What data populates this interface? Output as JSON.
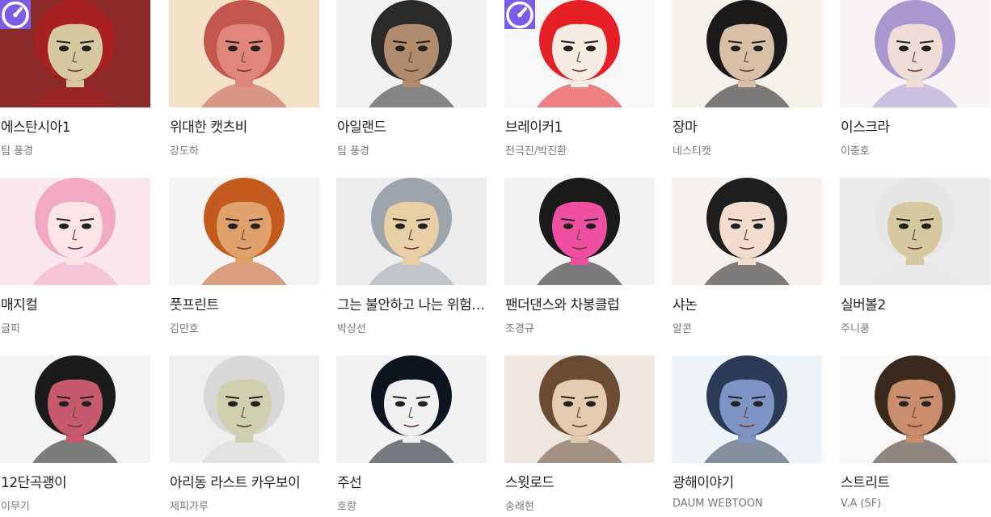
{
  "webtoons": [
    {
      "title": "에스탄시아1",
      "author": "팀 풍경",
      "badge": true,
      "thumb_icon": "red-haired-man-portrait",
      "bg": "#8b2a2a",
      "skin": "#d8c8a0",
      "hair": "#a82020"
    },
    {
      "title": "위대한 캣츠비",
      "author": "강도하",
      "badge": false,
      "thumb_icon": "cat-character-portrait",
      "bg": "#f3e2c8",
      "skin": "#e0857a",
      "hair": "#c4574c"
    },
    {
      "title": "아일랜드",
      "author": "팀 풍경",
      "badge": false,
      "thumb_icon": "dark-haired-man-portrait",
      "bg": "#f1f1f1",
      "skin": "#b08c6c",
      "hair": "#2a2a2a"
    },
    {
      "title": "브레이커1",
      "author": "전극진/박진환",
      "badge": true,
      "thumb_icon": "red-haired-boy-portrait",
      "bg": "#f7f7f7",
      "skin": "#f6ece2",
      "hair": "#e61e25"
    },
    {
      "title": "장마",
      "author": "네스티캣",
      "badge": false,
      "thumb_icon": "man-in-suit-portrait",
      "bg": "#f4f0ea",
      "skin": "#d8bfa8",
      "hair": "#1a1a1a"
    },
    {
      "title": "이스크라",
      "author": "이충호",
      "badge": false,
      "thumb_icon": "purple-haired-girl-portrait",
      "bg": "#f7f2f4",
      "skin": "#f1ddd8",
      "hair": "#a998d0"
    },
    {
      "title": "매지컬",
      "author": "글피",
      "badge": false,
      "thumb_icon": "pink-haired-girl-portrait",
      "bg": "#fbe7ef",
      "skin": "#fbe3e6",
      "hair": "#f1a9c3"
    },
    {
      "title": "풋프린트",
      "author": "김만호",
      "badge": false,
      "thumb_icon": "orange-haired-man-portrait",
      "bg": "#f4f4f4",
      "skin": "#e0a16a",
      "hair": "#c55a1e"
    },
    {
      "title": "그는 불안하고 나는 위험하다",
      "author": "박상선",
      "badge": false,
      "thumb_icon": "laughing-girl-portrait",
      "bg": "#ececec",
      "skin": "#e8cfa5",
      "hair": "#9ea4ab"
    },
    {
      "title": "팬더댄스와 차봉클럽",
      "author": "조경규",
      "badge": false,
      "thumb_icon": "panda-character-portrait",
      "bg": "#f2f2f2",
      "skin": "#ee4fa1",
      "hair": "#1a1a1a"
    },
    {
      "title": "샤논",
      "author": "알콘",
      "badge": false,
      "thumb_icon": "dark-haired-woman-portrait",
      "bg": "#f5f1ee",
      "skin": "#f3dccd",
      "hair": "#1e1e1e"
    },
    {
      "title": "실버볼2",
      "author": "주니쿵",
      "badge": false,
      "thumb_icon": "old-man-portrait",
      "bg": "#eaeaea",
      "skin": "#d6c9a0",
      "hair": "#e6e6e6"
    },
    {
      "title": "12단곡괭이",
      "author": "이무기",
      "badge": false,
      "thumb_icon": "girl-in-orange-portrait",
      "bg": "#f3f3f3",
      "skin": "#c75a6c",
      "hair": "#1b1b1b"
    },
    {
      "title": "아리동 라스트 카우보이",
      "author": "제피가루",
      "badge": false,
      "thumb_icon": "old-man-with-glasses-portrait",
      "bg": "#eef0ee",
      "skin": "#cfd0b0",
      "hair": "#d8d8d8"
    },
    {
      "title": "주선",
      "author": "호랑",
      "badge": false,
      "thumb_icon": "long-haired-man-portrait",
      "bg": "#f2f2f2",
      "skin": "#f0f0f0",
      "hair": "#0e1420"
    },
    {
      "title": "스윗로드",
      "author": "송래현",
      "badge": false,
      "thumb_icon": "brown-haired-woman-portrait",
      "bg": "#ede7df",
      "skin": "#e3cbb0",
      "hair": "#6a4b34"
    },
    {
      "title": "광해이야기",
      "author": "DAUM WEBTOON",
      "badge": false,
      "thumb_icon": "man-with-glasses-portrait",
      "bg": "#eef3f7",
      "skin": "#7d94c4",
      "hair": "#2b3a55"
    },
    {
      "title": "스트리트",
      "author": "V.A (SF)",
      "badge": false,
      "thumb_icon": "fighter-character-portrait",
      "bg": "#f7f7f7",
      "skin": "#c98d6c",
      "hair": "#3a2a1e"
    }
  ],
  "badge_icon": "speedometer-icon",
  "badge_color": "#7b5ce6"
}
